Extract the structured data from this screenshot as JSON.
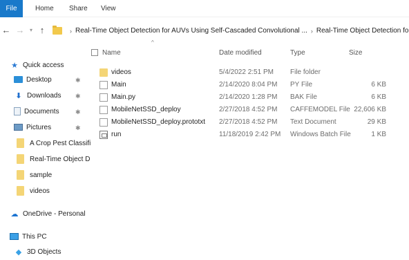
{
  "ribbon": {
    "tabs": [
      {
        "label": "File"
      },
      {
        "label": "Home"
      },
      {
        "label": "Share"
      },
      {
        "label": "View"
      }
    ]
  },
  "nav": {
    "back": "←",
    "forward": "→",
    "recent": "▾",
    "up": "↑",
    "breadcrumb": [
      "Real-Time Object Detection for AUVs Using Self-Cascaded Convolutional ...",
      "Real-Time Object Detection for AUVs Using Self-"
    ]
  },
  "sidebar": {
    "items": [
      {
        "label": "Quick access",
        "icon": "star-icon",
        "pinned": false
      },
      {
        "label": "Desktop",
        "icon": "desktop-icon",
        "pinned": true
      },
      {
        "label": "Downloads",
        "icon": "download-arrow-icon",
        "pinned": true
      },
      {
        "label": "Documents",
        "icon": "documents-icon",
        "pinned": true
      },
      {
        "label": "Pictures",
        "icon": "pictures-icon",
        "pinned": true
      },
      {
        "label": "A Crop Pest Classifi",
        "icon": "folder-icon",
        "pinned": false
      },
      {
        "label": "Real-Time Object D",
        "icon": "folder-icon",
        "pinned": false
      },
      {
        "label": "sample",
        "icon": "folder-icon",
        "pinned": false
      },
      {
        "label": "videos",
        "icon": "folder-icon",
        "pinned": false
      },
      {
        "label": "OneDrive - Personal",
        "icon": "onedrive-cloud-icon",
        "pinned": false
      },
      {
        "label": "This PC",
        "icon": "this-pc-icon",
        "pinned": false
      },
      {
        "label": "3D Objects",
        "icon": "3d-objects-icon",
        "pinned": false
      }
    ],
    "pin_glyph": "✱"
  },
  "columns": {
    "name": "Name",
    "date": "Date modified",
    "type": "Type",
    "size": "Size",
    "sort_arrow": "^"
  },
  "files": [
    {
      "name": "videos",
      "date": "5/4/2022 2:51 PM",
      "type": "File folder",
      "size": "",
      "icon": "folder-icon"
    },
    {
      "name": "Main",
      "date": "2/14/2020 8:04 PM",
      "type": "PY File",
      "size": "6 KB",
      "icon": "file-icon"
    },
    {
      "name": "Main.py",
      "date": "2/14/2020 1:28 PM",
      "type": "BAK File",
      "size": "6 KB",
      "icon": "file-icon"
    },
    {
      "name": "MobileNetSSD_deploy",
      "date": "2/27/2018 4:52 PM",
      "type": "CAFFEMODEL File",
      "size": "22,606 KB",
      "icon": "file-icon"
    },
    {
      "name": "MobileNetSSD_deploy.prototxt",
      "date": "2/27/2018 4:52 PM",
      "type": "Text Document",
      "size": "29 KB",
      "icon": "file-icon"
    },
    {
      "name": "run",
      "date": "11/18/2019 2:42 PM",
      "type": "Windows Batch File",
      "size": "1 KB",
      "icon": "batch-file-icon"
    }
  ],
  "colors": {
    "file_tab": "#1979ca",
    "folder": "#f4d576",
    "accent": "#2a7ad3"
  }
}
